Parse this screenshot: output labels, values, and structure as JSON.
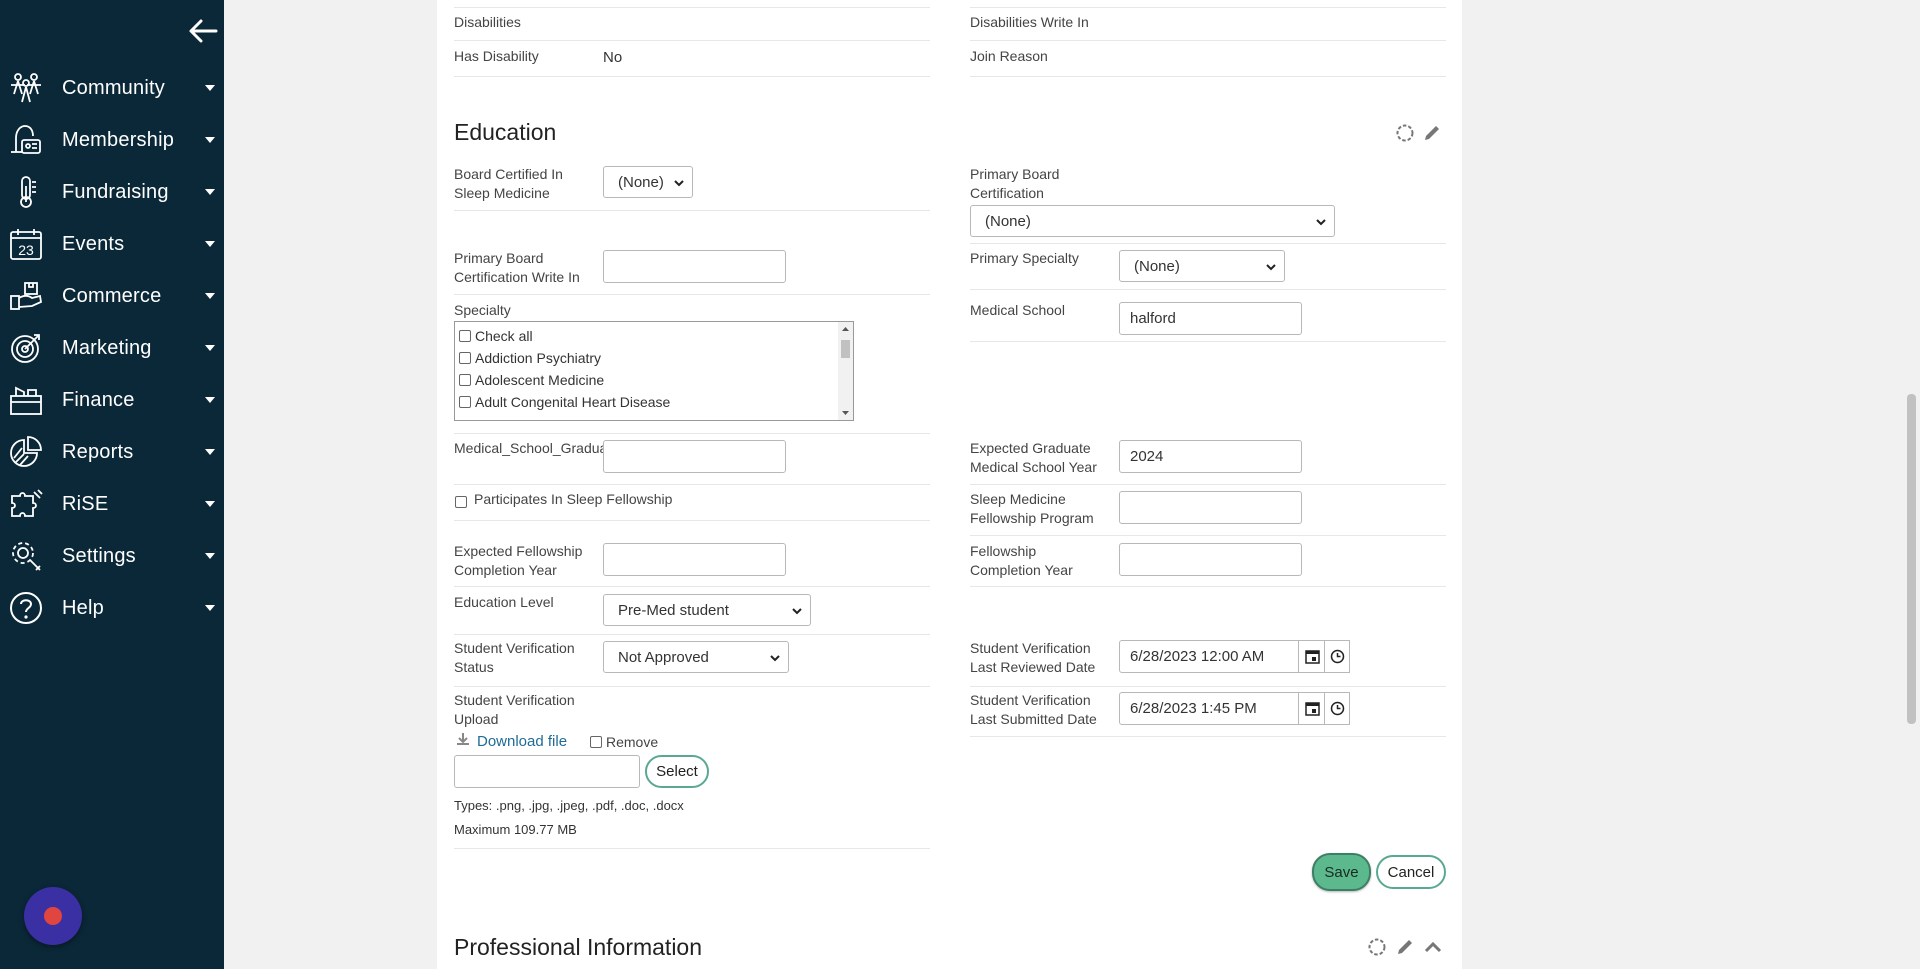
{
  "sidebar": {
    "items": [
      {
        "label": "Community",
        "icon": "community-icon"
      },
      {
        "label": "Membership",
        "icon": "membership-icon"
      },
      {
        "label": "Fundraising",
        "icon": "fundraising-icon"
      },
      {
        "label": "Events",
        "icon": "calendar-icon"
      },
      {
        "label": "Commerce",
        "icon": "commerce-icon"
      },
      {
        "label": "Marketing",
        "icon": "target-icon"
      },
      {
        "label": "Finance",
        "icon": "finance-icon"
      },
      {
        "label": "Reports",
        "icon": "pie-chart-icon"
      },
      {
        "label": "RiSE",
        "icon": "puzzle-icon"
      },
      {
        "label": "Settings",
        "icon": "gear-icon"
      },
      {
        "label": "Help",
        "icon": "help-icon"
      }
    ],
    "events_day": "23"
  },
  "top_rows": {
    "disabilities_label": "Disabilities",
    "disabilities_write_in_label": "Disabilities Write In",
    "has_disability_label": "Has Disability",
    "has_disability_value": "No",
    "join_reason_label": "Join Reason"
  },
  "education": {
    "title": "Education",
    "board_certified_label": "Board Certified In Sleep Medicine",
    "board_certified_value": "(None)",
    "primary_board_cert_label": "Primary Board Certification",
    "primary_board_cert_value": "(None)",
    "primary_board_cert_write_in_label": "Primary Board Certification Write In",
    "primary_board_cert_write_in_value": "",
    "primary_specialty_label": "Primary Specialty",
    "primary_specialty_value": "(None)",
    "specialty_label": "Specialty",
    "specialty_options": [
      "Check all",
      "Addiction Psychiatry",
      "Adolescent Medicine",
      "Adult Congenital Heart Disease"
    ],
    "medical_school_label": "Medical School",
    "medical_school_value": "halford",
    "med_school_grad_year_label": "Medical_School_Graduation_Year",
    "med_school_grad_year_value": "",
    "expected_grad_label": "Expected Graduate Medical School Year",
    "expected_grad_value": "2024",
    "sleep_fellowship_label": "Participates In Sleep Fellowship",
    "sleep_fellowship_program_label": "Sleep Medicine Fellowship Program",
    "sleep_fellowship_program_value": "",
    "expected_fellowship_label": "Expected Fellowship Completion Year",
    "expected_fellowship_value": "",
    "fellowship_completion_label": "Fellowship Completion Year",
    "fellowship_completion_value": "",
    "education_level_label": "Education Level",
    "education_level_value": "Pre-Med student",
    "verification_status_label": "Student Verification Status",
    "verification_status_value": "Not Approved",
    "last_reviewed_label": "Student Verification Last Reviewed Date",
    "last_reviewed_value": "6/28/2023 12:00 AM",
    "last_submitted_label": "Student Verification Last Submitted Date",
    "last_submitted_value": "6/28/2023 1:45 PM",
    "upload_label": "Student Verification Upload",
    "download_label": "Download file",
    "remove_label": "Remove",
    "file_input_value": "",
    "select_label": "Select",
    "types_text": "Types: .png, .jpg, .jpeg, .pdf, .doc, .docx",
    "max_text": "Maximum 109.77 MB",
    "save_label": "Save",
    "cancel_label": "Cancel"
  },
  "professional": {
    "title": "Professional Information"
  },
  "colors": {
    "sidebar_bg": "#0b2838",
    "save_bg": "#5cb98d",
    "button_border": "#5ba892",
    "link": "#1f6b96",
    "help_bubble": "#3b2fa4"
  }
}
